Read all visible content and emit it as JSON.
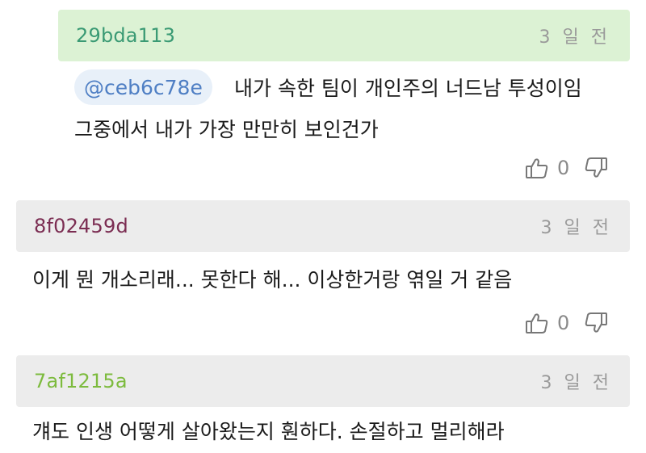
{
  "comments": [
    {
      "username": "29bda113",
      "time": "3 일 전",
      "mention": "@ceb6c78e",
      "text_line1": "내가 속한 팀이 개인주의 너드남 투성이임",
      "text_line2": "그중에서 내가 가장 만만히 보인건가",
      "likes": "0"
    },
    {
      "username": "8f02459d",
      "time": "3 일 전",
      "text": "이게 뭔 개소리래... 못한다 해... 이상한거랑 엮일 거 같음",
      "likes": "0"
    },
    {
      "username": "7af1215a",
      "time": "3 일 전",
      "text": "걔도 인생 어떻게 살아왔는지 훤하다. 손절하고 멀리해라"
    }
  ],
  "colors": {
    "reply_header_bg": "#dcf2d4",
    "header_bg": "#ececec",
    "mention_text": "#4f7fc4"
  },
  "icons": [
    "thumbs-up-icon",
    "thumbs-down-icon"
  ]
}
